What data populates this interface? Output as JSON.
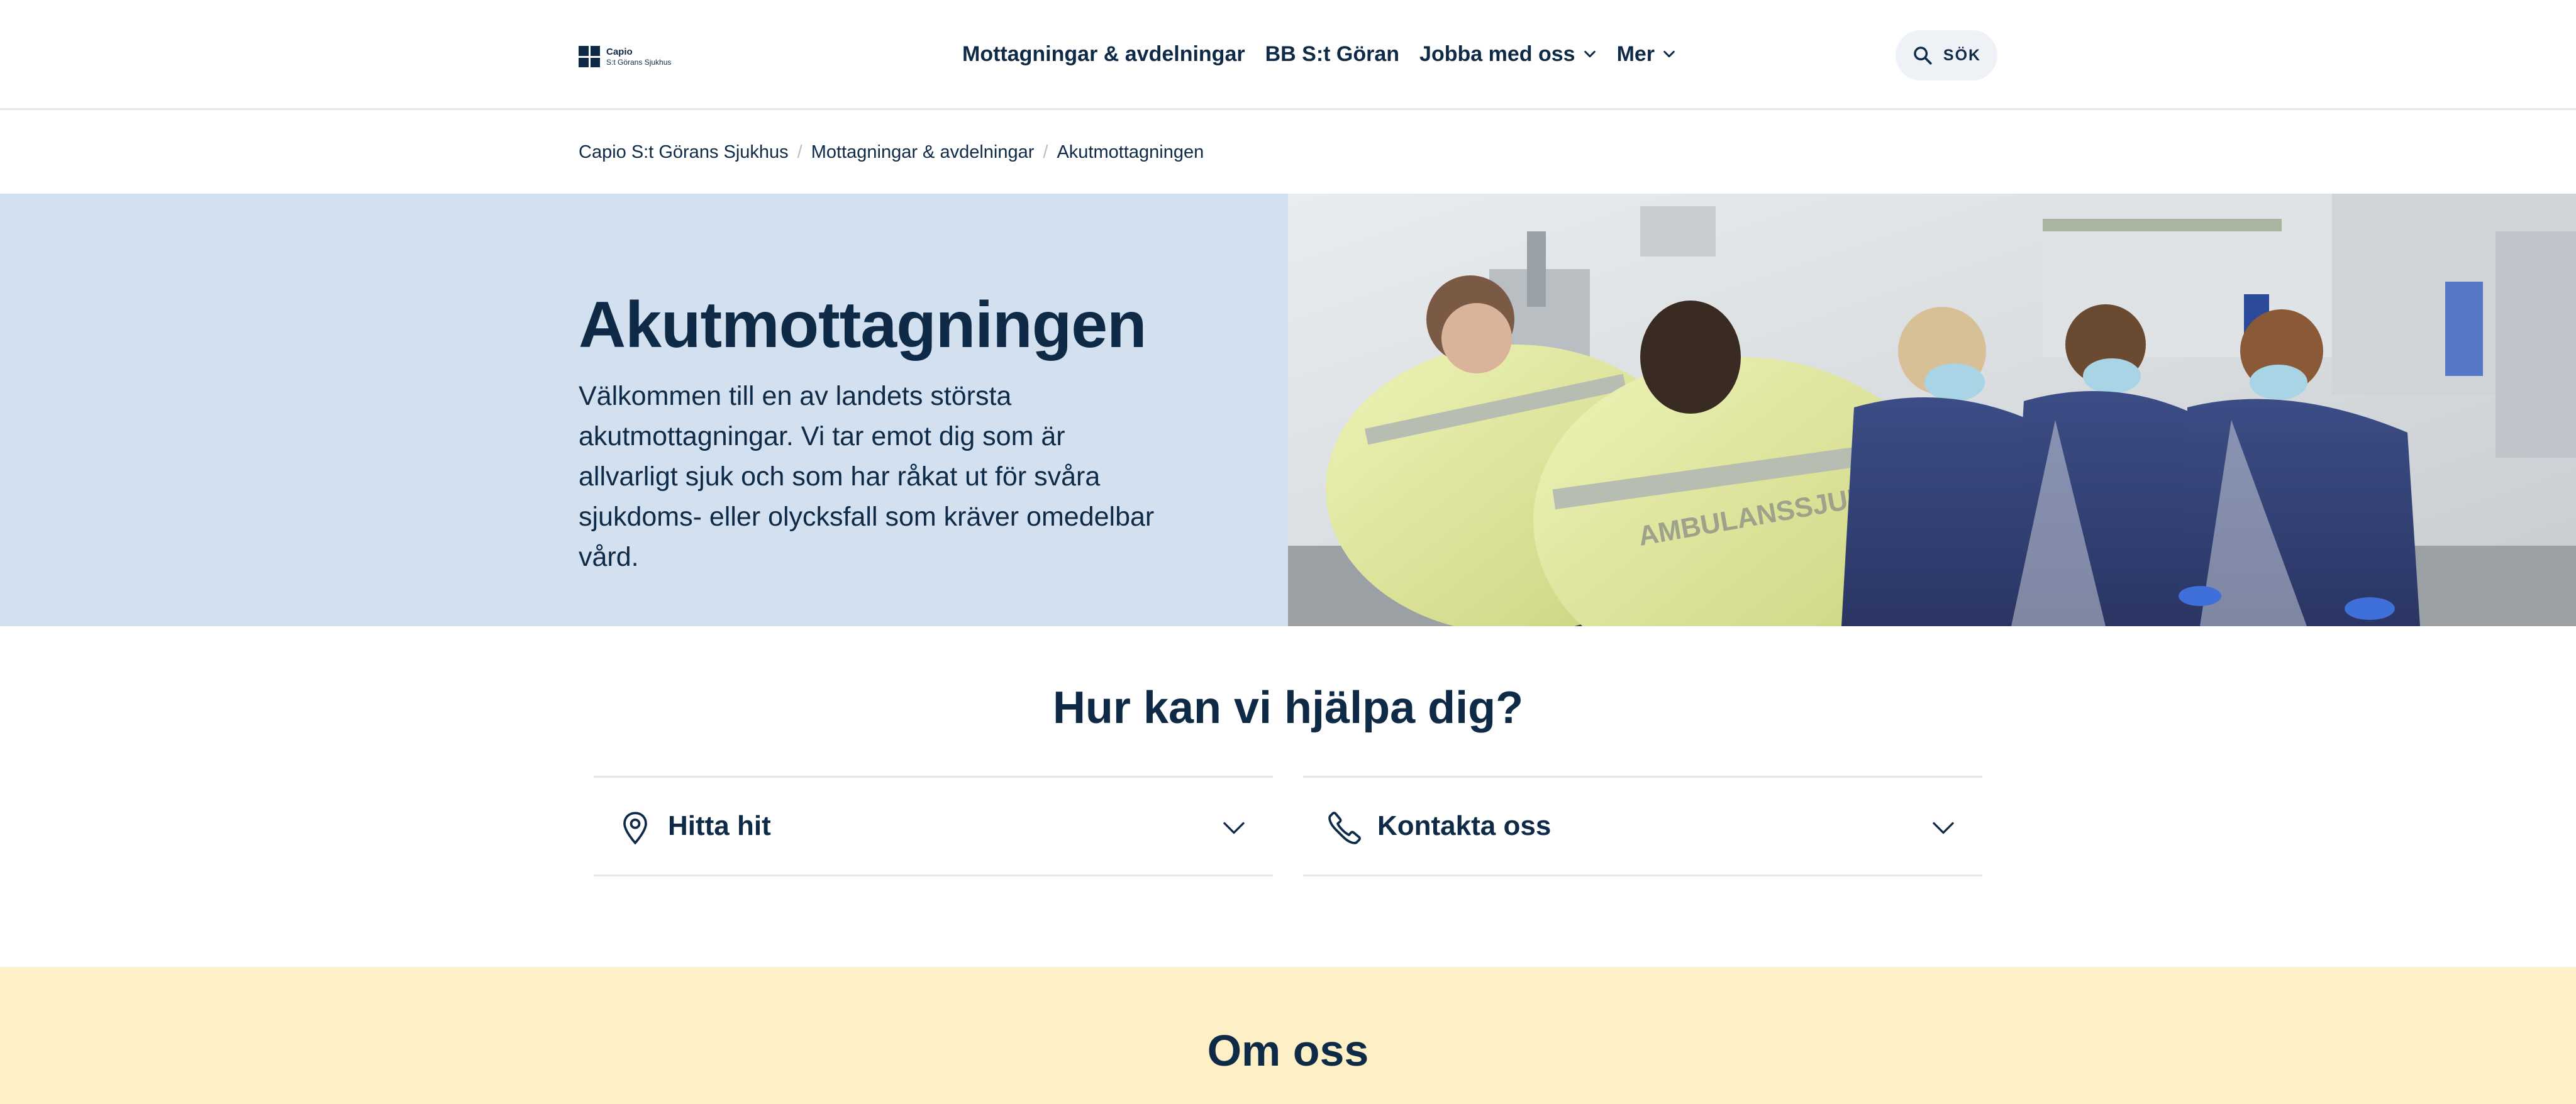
{
  "header": {
    "logo": {
      "line1": "Capio",
      "line2": "S:t Görans Sjukhus"
    },
    "nav": [
      {
        "label": "Mottagningar & avdelningar",
        "has_dropdown": false
      },
      {
        "label": "BB S:t Göran",
        "has_dropdown": false
      },
      {
        "label": "Jobba med oss",
        "has_dropdown": true
      },
      {
        "label": "Mer",
        "has_dropdown": true
      }
    ],
    "search_label": "SÖK"
  },
  "breadcrumb": {
    "items": [
      "Capio S:t Görans Sjukhus",
      "Mottagningar & avdelningar",
      "Akutmottagningen"
    ]
  },
  "hero": {
    "title": "Akutmottagningen",
    "text": "Välkommen till en av landets största akutmottagningar. Vi tar emot dig som är allvarligt sjuk och som har råkat ut för svåra sjukdoms- eller olycksfall som kräver omedelbar vård.",
    "image_text": "AMBULANSSJUKVÅRD"
  },
  "help": {
    "title": "Hur kan vi hjälpa dig?",
    "items": [
      {
        "label": "Hitta hit",
        "icon": "map-pin-icon"
      },
      {
        "label": "Kontakta oss",
        "icon": "phone-icon"
      }
    ]
  },
  "about": {
    "title": "Om oss"
  },
  "colors": {
    "primary": "#0e2a47",
    "hero_bg": "#d3e0ef",
    "about_bg": "#fdf0c6",
    "divider": "#e3e6ea"
  }
}
